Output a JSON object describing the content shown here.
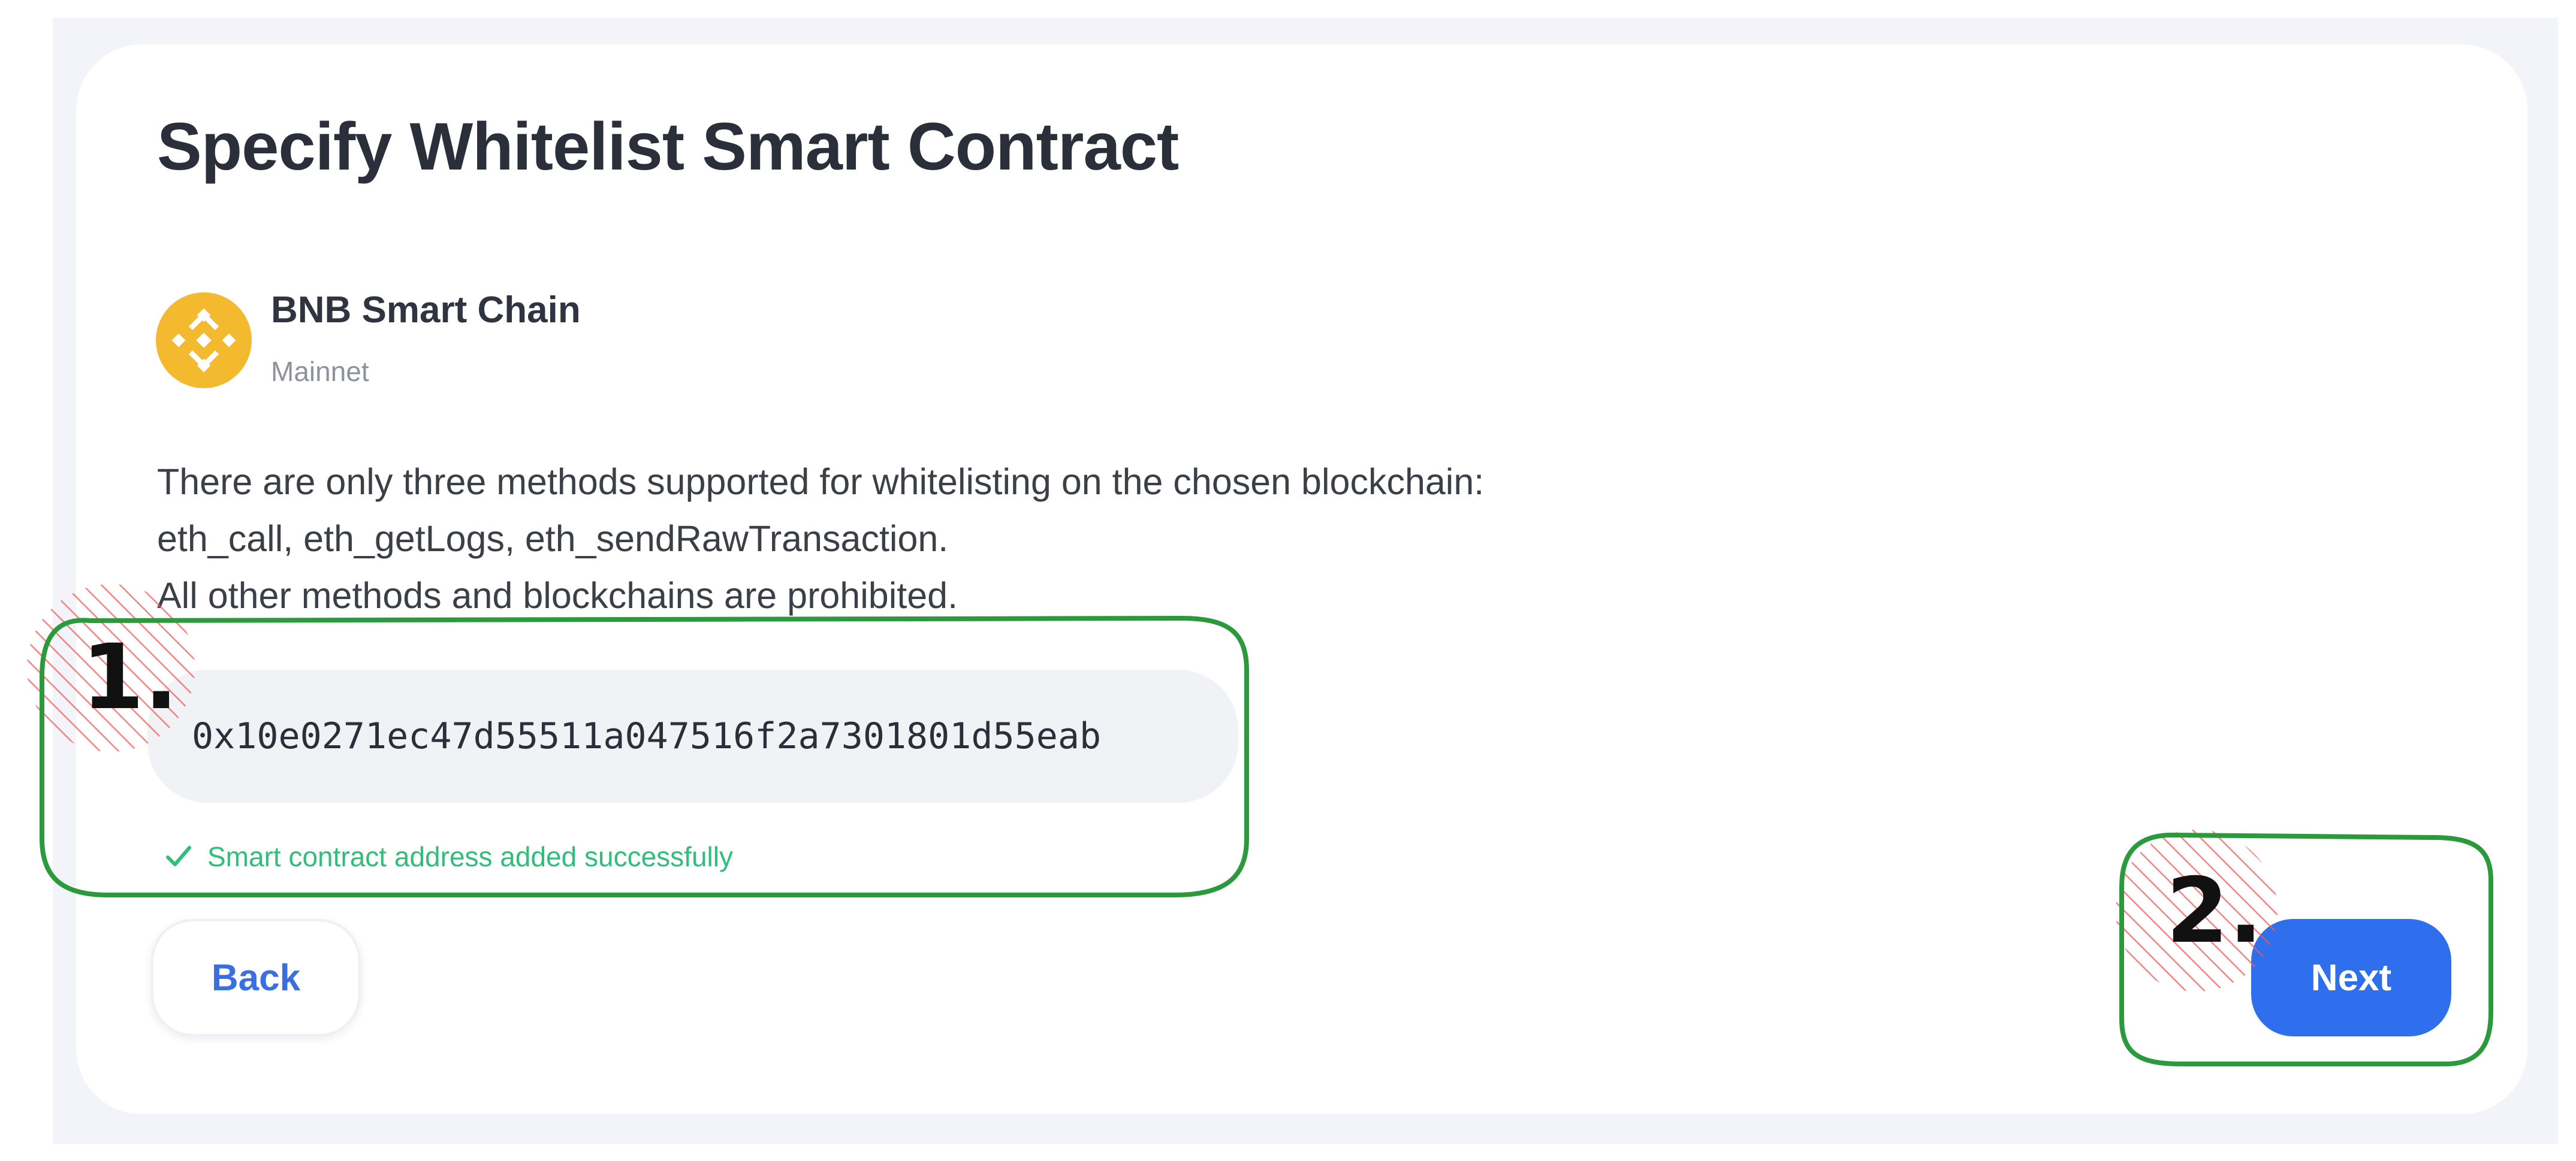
{
  "page": {
    "title": "Specify Whitelist Smart Contract"
  },
  "chain": {
    "name": "BNB Smart Chain",
    "network": "Mainnet",
    "logo_icon": "bnb-logo-icon",
    "logo_color": "#f3ba2f"
  },
  "description": {
    "lines": [
      "There are only three methods supported for whitelisting on the chosen blockchain:",
      "eth_call, eth_getLogs, eth_sendRawTransaction.",
      "All other methods and blockchains are prohibited."
    ]
  },
  "address_field": {
    "value": "0x10e0271ec47d55511a047516f2a7301801d55eab"
  },
  "status": {
    "icon": "check-icon",
    "text": "Smart contract address added successfully",
    "color": "#2fbf7a"
  },
  "buttons": {
    "back_label": "Back",
    "next_label": "Next",
    "next_color": "#2f6fee"
  },
  "annotations": {
    "step1_label": "1.",
    "step2_label": "2.",
    "box_color": "#2a9a3c",
    "hatch_color": "#f25a5a"
  }
}
